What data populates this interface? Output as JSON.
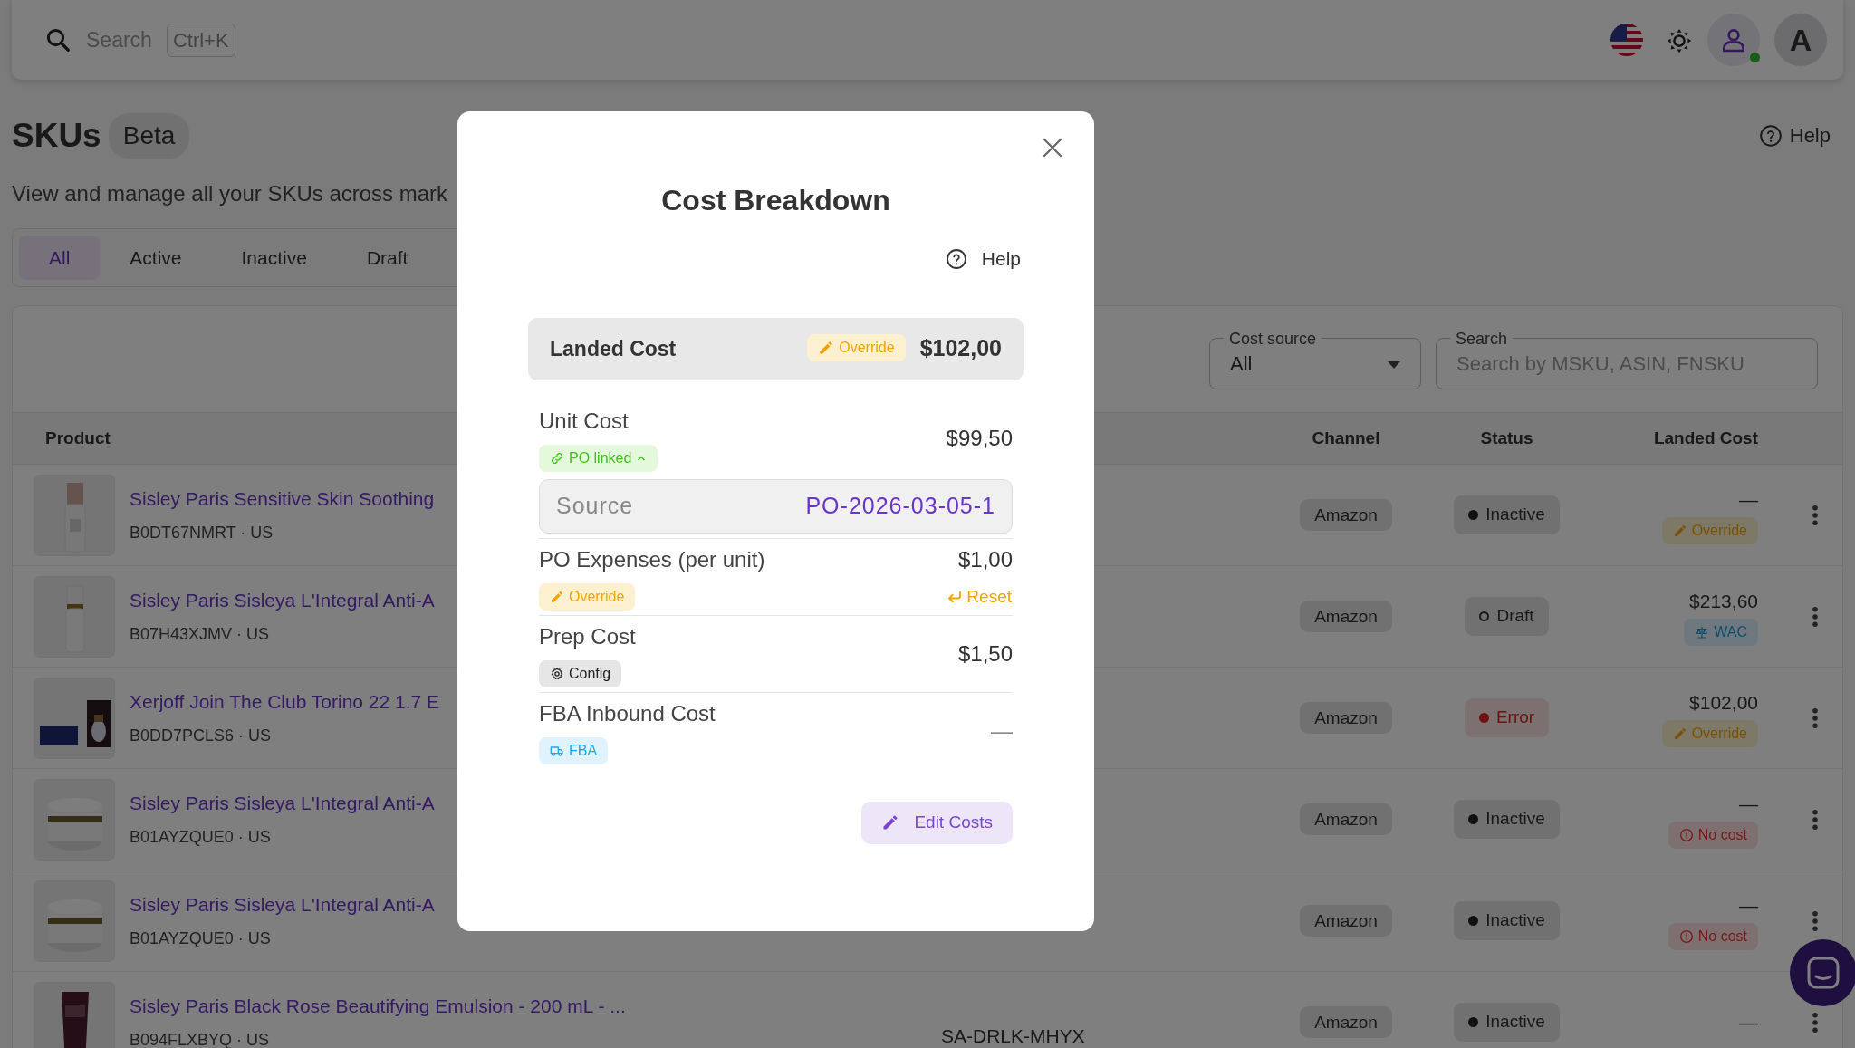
{
  "topbar": {
    "search": {
      "placeholder": "Search",
      "shortcut": "Ctrl+K"
    },
    "user": {
      "online": true
    },
    "avatar": "A"
  },
  "header": {
    "title": "SKUs",
    "badge": "Beta",
    "help": "Help",
    "subtitle": "View and manage all your SKUs across mark"
  },
  "tabs": [
    {
      "label": "All",
      "selected": true
    },
    {
      "label": "Active",
      "selected": false
    },
    {
      "label": "Inactive",
      "selected": false
    },
    {
      "label": "Draft",
      "selected": false
    }
  ],
  "filters": {
    "cost_source": {
      "label": "Cost source",
      "value": "All"
    },
    "search": {
      "label": "Search",
      "placeholder": "Search by MSKU, ASIN, FNSKU"
    }
  },
  "table": {
    "columns": [
      "Product",
      "Channel",
      "Status",
      "Landed Cost"
    ],
    "rows": [
      {
        "name": "Sisley Paris Sensitive Skin Soothing",
        "asin_line": "B0DT67NMRT · US",
        "channel": "Amazon",
        "status": {
          "label": "Inactive",
          "kind": "inactive"
        },
        "landed_cost": "—",
        "cost_badge": {
          "label": "Override",
          "kind": "override"
        }
      },
      {
        "name": "Sisley Paris Sisleya L'Integral Anti-A",
        "asin_line": "B07H43XJMV · US",
        "channel": "Amazon",
        "status": {
          "label": "Draft",
          "kind": "draft"
        },
        "landed_cost": "$213,60",
        "cost_badge": {
          "label": "WAC",
          "kind": "wac"
        }
      },
      {
        "name": "Xerjoff Join The Club Torino 22 1.7 E",
        "asin_line": "B0DD7PCLS6 · US",
        "channel": "Amazon",
        "status": {
          "label": "Error",
          "kind": "error"
        },
        "landed_cost": "$102,00",
        "cost_badge": {
          "label": "Override",
          "kind": "override"
        }
      },
      {
        "name": "Sisley Paris Sisleya L'Integral Anti-A",
        "asin_line": "B01AYZQUE0 · US",
        "channel": "Amazon",
        "status": {
          "label": "Inactive",
          "kind": "inactive"
        },
        "landed_cost": "—",
        "cost_badge": {
          "label": "No cost",
          "kind": "nocost"
        }
      },
      {
        "name": "Sisley Paris Sisleya L'Integral Anti-A",
        "asin_line": "B01AYZQUE0 · US",
        "channel": "Amazon",
        "status": {
          "label": "Inactive",
          "kind": "inactive"
        },
        "landed_cost": "—",
        "cost_badge": {
          "label": "No cost",
          "kind": "nocost"
        }
      },
      {
        "name": "Sisley Paris Black Rose Beautifying Emulsion - 200 mL - ...",
        "asin_line": "B094FLXBYQ · US",
        "column_2": "SA-DRLK-MHYX",
        "channel": "Amazon",
        "status": {
          "label": "Inactive",
          "kind": "inactive"
        },
        "landed_cost": "—"
      }
    ]
  },
  "modal": {
    "title": "Cost Breakdown",
    "help": "Help",
    "landed": {
      "label": "Landed Cost",
      "badge": {
        "label": "Override",
        "kind": "override"
      },
      "value": "$102,00"
    },
    "lines": [
      {
        "label": "Unit Cost",
        "value": "$99,50",
        "tag": {
          "label": "PO linked",
          "kind": "po",
          "expanded": true
        },
        "source": {
          "label": "Source",
          "value": "PO-2026-03-05-1"
        }
      },
      {
        "label": "PO Expenses (per unit)",
        "value": "$1,00",
        "tag": {
          "label": "Override",
          "kind": "override"
        },
        "action": "Reset"
      },
      {
        "label": "Prep Cost",
        "value": "$1,50",
        "tag": {
          "label": "Config",
          "kind": "config"
        }
      },
      {
        "label": "FBA Inbound Cost",
        "value": "—",
        "tag": {
          "label": "FBA",
          "kind": "fba"
        }
      }
    ],
    "button": "Edit Costs"
  }
}
